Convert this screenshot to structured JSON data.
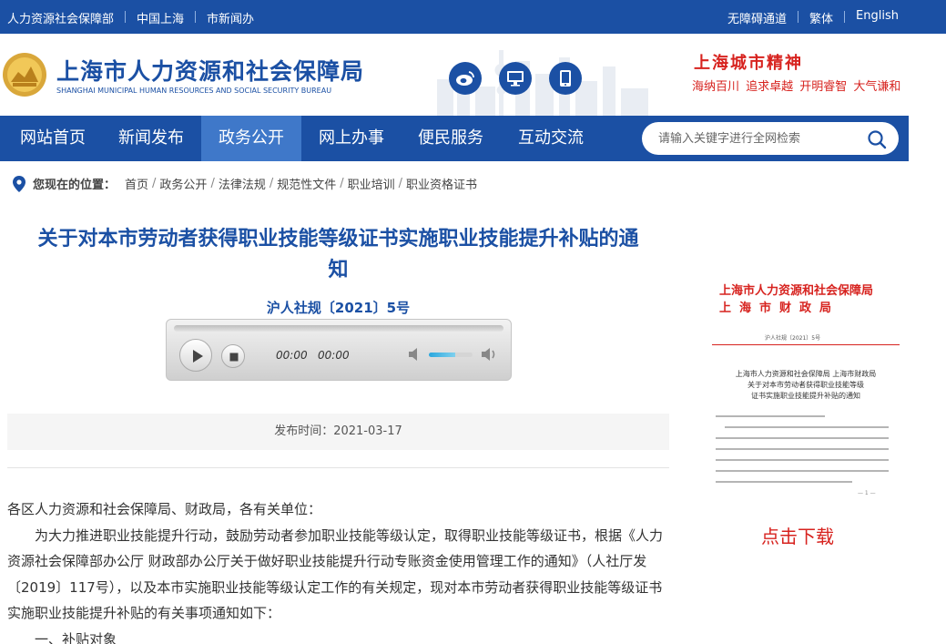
{
  "topbar": {
    "left": [
      "人力资源社会保障部",
      "中国上海",
      "市新闻办"
    ],
    "right": [
      "无障碍通道",
      "繁体",
      "English"
    ]
  },
  "header": {
    "name_cn": "上海市人力资源和社会保障局",
    "name_en": "SHANGHAI MUNICIPAL HUMAN RESOURCES AND SOCIAL SECURITY BUREAU",
    "social_icons": [
      "weibo-icon",
      "monitor-icon",
      "mobile-icon"
    ],
    "spirit_title": "上海城市精神",
    "spirit_text": "海纳百川 追求卓越 开明睿智 大气谦和"
  },
  "nav": {
    "items": [
      "网站首页",
      "新闻发布",
      "政务公开",
      "网上办事",
      "便民服务",
      "互动交流"
    ],
    "active": "政务公开",
    "search_placeholder": "请输入关键字进行全网检索"
  },
  "breadcrumb": {
    "label": "您现在的位置：",
    "items": [
      "首页",
      "政务公开",
      "法律法规",
      "规范性文件",
      "职业培训",
      "职业资格证书"
    ]
  },
  "article": {
    "title_line1": "关于对本市劳动者获得职业技能等级证书实施职业技能提升补贴的通",
    "title_line2": "知",
    "doc_no": "沪人社规〔2021〕5号",
    "player": {
      "current": "00:00",
      "duration": "00:00",
      "volume": 0.6
    },
    "publish": "发布时间：2021-03-17",
    "salutation": "各区人力资源和社会保障局、财政局，各有关单位：",
    "para1": "为大力推进职业技能提升行动，鼓励劳动者参加职业技能等级认定，取得职业技能等级证书，根据《人力资源社会保障部办公厅 财政部办公厅关于做好职业技能提升行动专账资金使用管理工作的通知》（人社厅发〔2019〕117号），以及本市实施职业技能等级认定工作的有关规定，现对本市劳动者获得职业技能等级证书实施职业技能提升补贴的有关事项通知如下：",
    "section1": "一、补贴对象"
  },
  "sidebar": {
    "doc_issuer1": "上海市人力资源和社会保障局",
    "doc_issuer2": "上海市财政局",
    "doc_no": "沪人社规〔2021〕5号",
    "doc_title1": "上海市人力资源和社会保障局 上海市财政局",
    "doc_title2": "关于对本市劳动者获得职业技能等级",
    "doc_title3": "证书实施职业技能提升补贴的通知",
    "page_no": "— 1 —",
    "download": "点击下载"
  },
  "colors": {
    "brand": "#1b50a4",
    "nav_active": "#3f78c9",
    "accent_red": "#d7231f"
  }
}
